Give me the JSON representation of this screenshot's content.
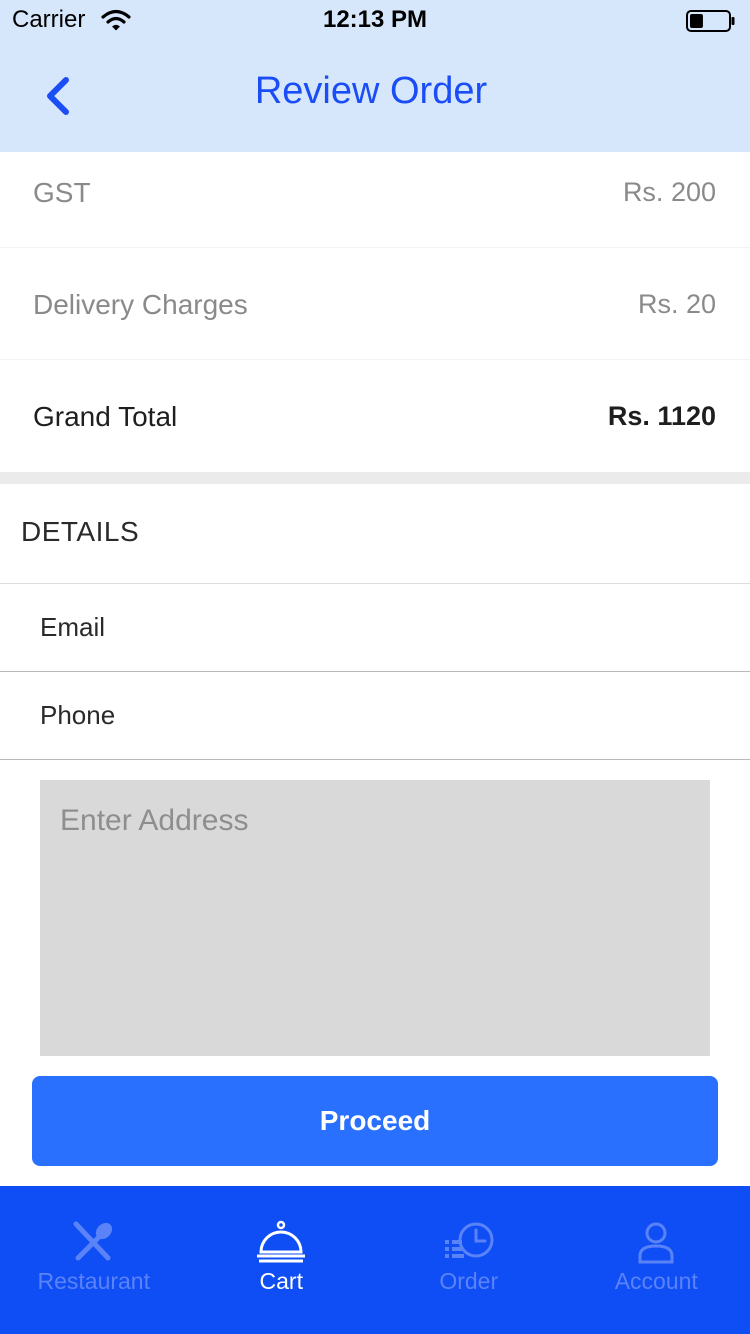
{
  "status_bar": {
    "carrier": "Carrier",
    "time": "12:13 PM",
    "battery_level": 0.35
  },
  "nav": {
    "title": "Review Order",
    "back_icon": "chevron-left-icon"
  },
  "summary": {
    "gst": {
      "label": "GST",
      "value": "Rs. 200"
    },
    "delivery": {
      "label": "Delivery Charges",
      "value": "Rs. 20"
    },
    "grand_total": {
      "label": "Grand Total",
      "value": "Rs. 1120"
    }
  },
  "details": {
    "title": "DETAILS",
    "email_label": "Email",
    "phone_label": "Phone",
    "address_placeholder": "Enter Address"
  },
  "proceed_label": "Proceed",
  "colors": {
    "accent": "#2a70ff",
    "tab_bar": "#0f4ef5",
    "header_bg": "#d6e7fb",
    "title": "#1a4df5"
  },
  "tab_bar": {
    "active": "cart",
    "tabs": [
      {
        "label": "Restaurant",
        "icon": "fork-spoon-icon"
      },
      {
        "label": "Cart",
        "icon": "service-bell-icon"
      },
      {
        "label": "Order",
        "icon": "order-history-icon"
      },
      {
        "label": "Account",
        "icon": "user-icon"
      }
    ]
  }
}
